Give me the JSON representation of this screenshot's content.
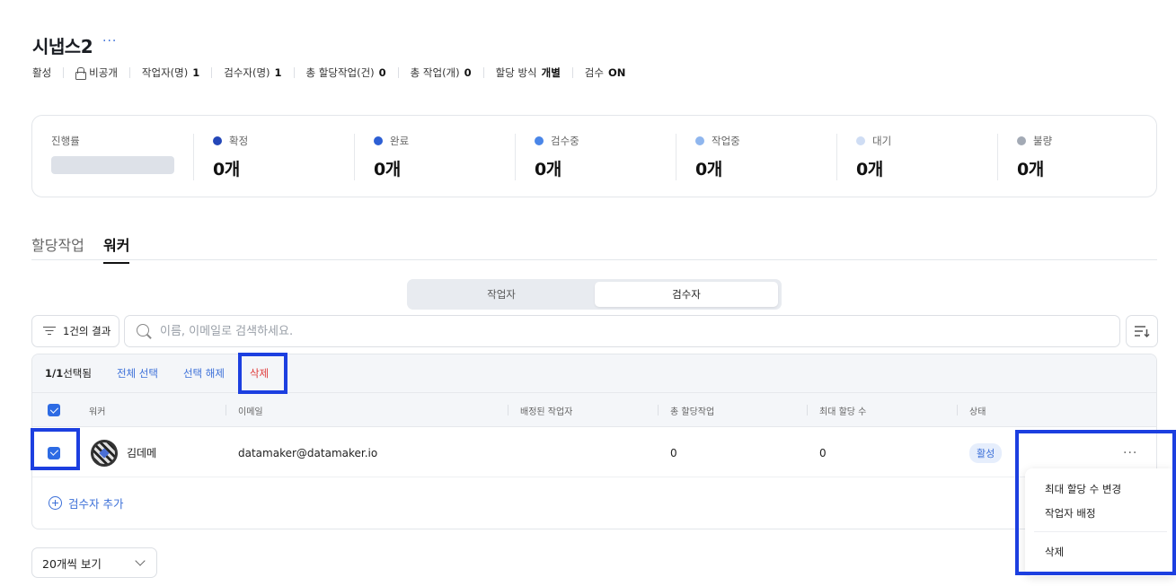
{
  "project": {
    "title": "시냅스2",
    "more": "···"
  },
  "meta": {
    "status": "활성",
    "visibility": "비공개",
    "workers_label": "작업자(명)",
    "workers_value": "1",
    "reviewers_label": "검수자(명)",
    "reviewers_value": "1",
    "assigned_label": "총 할당작업(건)",
    "assigned_value": "0",
    "tasks_label": "총 작업(개)",
    "tasks_value": "0",
    "method_label": "할당 방식",
    "method_value": "개별",
    "review_label": "검수",
    "review_value": "ON"
  },
  "progress": {
    "label": "진행률",
    "ratio": 0,
    "stats": [
      {
        "label": "확정",
        "value": "0개",
        "color": "#2447b8"
      },
      {
        "label": "완료",
        "value": "0개",
        "color": "#2d5fd4"
      },
      {
        "label": "검수중",
        "value": "0개",
        "color": "#4a86e8"
      },
      {
        "label": "작업중",
        "value": "0개",
        "color": "#8fb6ee"
      },
      {
        "label": "대기",
        "value": "0개",
        "color": "#cfddf4"
      },
      {
        "label": "불량",
        "value": "0개",
        "color": "#a3aab5"
      }
    ]
  },
  "tabs": [
    {
      "label": "할당작업"
    },
    {
      "label": "워커"
    }
  ],
  "segment": {
    "workers": "작업자",
    "reviewers": "검수자"
  },
  "toolbar": {
    "result": "1건의 결과",
    "search_placeholder": "이름, 이메일로 검색하세요.",
    "sort_icon": "sort-icon"
  },
  "selection": {
    "count": "1/1",
    "count_suffix": "선택됨",
    "select_all": "전체 선택",
    "deselect": "선택 해제",
    "delete": "삭제"
  },
  "table": {
    "columns": [
      "워커",
      "이메일",
      "배정된 작업자",
      "총 할당작업",
      "최대 할당 수",
      "상태"
    ],
    "rows": [
      {
        "name": "김데메",
        "email": "datamaker@datamaker.io",
        "assigned_workers": "",
        "total_assigned": "0",
        "max_assign": "0",
        "status": "활성",
        "more": "···"
      }
    ],
    "add_label": "검수자 추가"
  },
  "pagination": {
    "page_size": "20개씩 보기"
  },
  "context_menu": {
    "items": [
      "최대 할당 수 변경",
      "작업자 배정",
      "삭제"
    ]
  },
  "colors": {
    "accent": "#3b6fd8",
    "danger": "#e03c3c",
    "highlight": "#1c3fe0"
  }
}
